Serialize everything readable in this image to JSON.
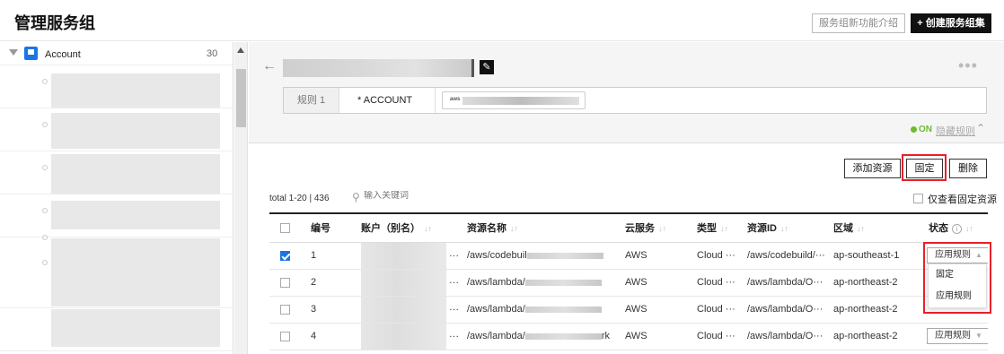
{
  "header": {
    "title": "管理服务组",
    "intro_button": "服务组新功能介绍",
    "create_button": "+ 创建服务组集"
  },
  "tree": {
    "root_label": "Account",
    "root_count": "30"
  },
  "detail": {
    "rule_label": "规则 1",
    "rule_key": "* ACCOUNT",
    "tag_icon": "aws",
    "status_on": "ON",
    "hide_rule": "隐藏规则"
  },
  "actions": {
    "add": "添加资源",
    "fix": "固定",
    "delete": "删除"
  },
  "list": {
    "total": "total 1-20 | 436",
    "search_placeholder": "输入关键词",
    "fixed_only": "仅查看固定资源"
  },
  "table": {
    "columns": [
      "编号",
      "账户（别名）",
      "资源名称",
      "云服务",
      "类型",
      "资源ID",
      "区域",
      "状态"
    ],
    "rows": [
      {
        "no": "1",
        "resource": "/aws/codebuil",
        "service": "AWS",
        "type": "Cloud ···",
        "res_id": "/aws/codebuild/···",
        "region": "ap-southeast-1",
        "status": "应用规则",
        "checked": true
      },
      {
        "no": "2",
        "resource": "/aws/lambda/",
        "service": "AWS",
        "type": "Cloud ···",
        "res_id": "/aws/lambda/O···",
        "region": "ap-northeast-2",
        "status": "应用规则",
        "checked": false
      },
      {
        "no": "3",
        "resource": "/aws/lambda/",
        "service": "AWS",
        "type": "Cloud ···",
        "res_id": "/aws/lambda/O···",
        "region": "ap-northeast-2",
        "status": "应用规则",
        "checked": false
      },
      {
        "no": "4",
        "resource": "/aws/lambda/",
        "resource_tail": "rk",
        "service": "AWS",
        "type": "Cloud ···",
        "res_id": "/aws/lambda/O···",
        "region": "ap-northeast-2",
        "status": "应用规则",
        "checked": false
      }
    ]
  },
  "dropdown": {
    "options": [
      "固定",
      "应用规则"
    ]
  },
  "colors": {
    "accent": "#1d74e5",
    "on_green": "#6dbb2f",
    "highlight_red": "#e8202a"
  }
}
